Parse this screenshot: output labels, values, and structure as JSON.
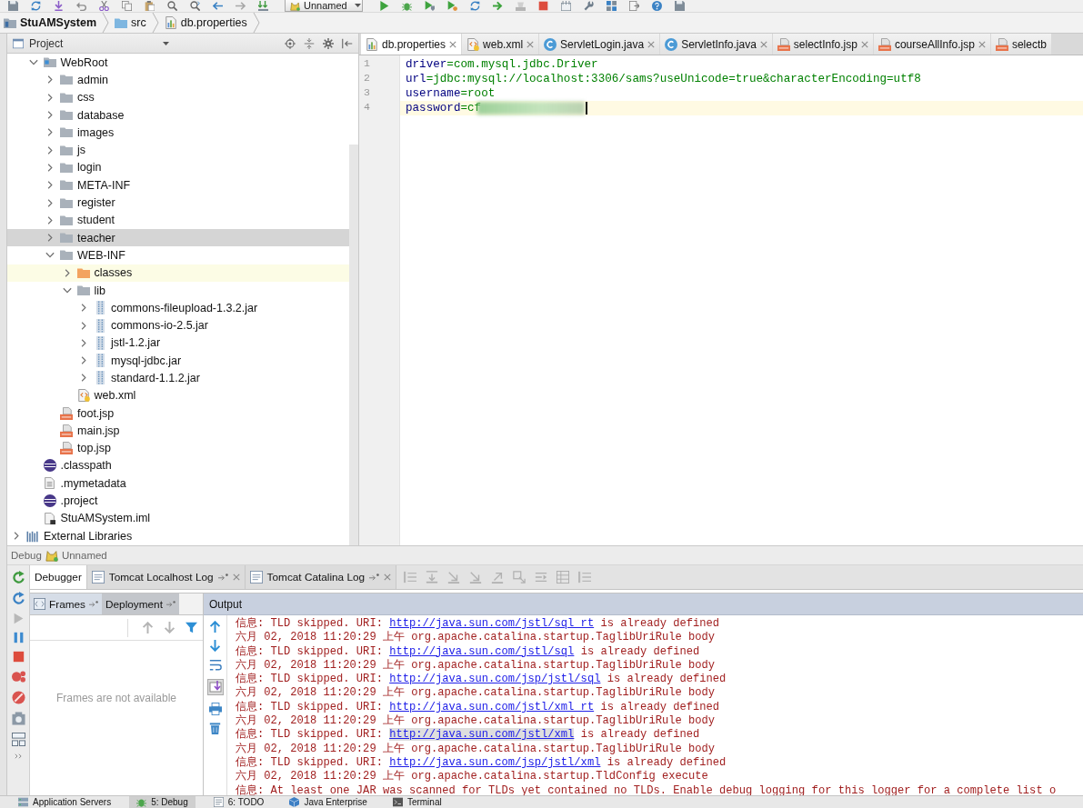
{
  "toolbar": {
    "run_configuration": "Unnamed"
  },
  "breadcrumbs": [
    {
      "label": "StuAMSystem",
      "kind": "module"
    },
    {
      "label": "src",
      "kind": "folder"
    },
    {
      "label": "db.properties",
      "kind": "properties"
    }
  ],
  "project_panel": {
    "title": "Project",
    "tree": {
      "scrolled_root_children": [
        {
          "label": "WebRoot",
          "kind": "web-folder",
          "expanded": true,
          "selected": false,
          "children": [
            {
              "label": "admin",
              "kind": "folder",
              "expanded": false,
              "selected": false
            },
            {
              "label": "css",
              "kind": "folder",
              "expanded": false,
              "selected": false
            },
            {
              "label": "database",
              "kind": "folder",
              "expanded": false,
              "selected": false
            },
            {
              "label": "images",
              "kind": "folder",
              "expanded": false,
              "selected": false
            },
            {
              "label": "js",
              "kind": "folder",
              "expanded": false,
              "selected": false
            },
            {
              "label": "login",
              "kind": "folder",
              "expanded": false,
              "selected": false
            },
            {
              "label": "META-INF",
              "kind": "folder",
              "expanded": false,
              "selected": false
            },
            {
              "label": "register",
              "kind": "folder",
              "expanded": false,
              "selected": false
            },
            {
              "label": "student",
              "kind": "folder",
              "expanded": false,
              "selected": false
            },
            {
              "label": "teacher",
              "kind": "folder",
              "expanded": false,
              "selected": true
            },
            {
              "label": "WEB-INF",
              "kind": "folder",
              "expanded": true,
              "selected": false,
              "children": [
                {
                  "label": "classes",
                  "kind": "excluded-folder",
                  "expanded": false,
                  "selected": false
                },
                {
                  "label": "lib",
                  "kind": "folder",
                  "expanded": true,
                  "selected": false,
                  "children": [
                    {
                      "label": "commons-fileupload-1.3.2.jar",
                      "kind": "jar",
                      "expanded": false,
                      "selected": false
                    },
                    {
                      "label": "commons-io-2.5.jar",
                      "kind": "jar",
                      "expanded": false,
                      "selected": false
                    },
                    {
                      "label": "jstl-1.2.jar",
                      "kind": "jar",
                      "expanded": false,
                      "selected": false
                    },
                    {
                      "label": "mysql-jdbc.jar",
                      "kind": "jar",
                      "expanded": false,
                      "selected": false
                    },
                    {
                      "label": "standard-1.1.2.jar",
                      "kind": "jar",
                      "expanded": false,
                      "selected": false
                    }
                  ]
                },
                {
                  "label": "web.xml",
                  "kind": "xml",
                  "selected": false
                }
              ]
            },
            {
              "label": "foot.jsp",
              "kind": "jsp",
              "selected": false
            },
            {
              "label": "main.jsp",
              "kind": "jsp",
              "selected": false
            },
            {
              "label": "top.jsp",
              "kind": "jsp",
              "selected": false
            }
          ]
        },
        {
          "label": ".classpath",
          "kind": "eclipse",
          "selected": false
        },
        {
          "label": ".mymetadata",
          "kind": "text",
          "selected": false
        },
        {
          "label": ".project",
          "kind": "eclipse",
          "selected": false
        },
        {
          "label": "StuAMSystem.iml",
          "kind": "iml",
          "selected": false
        }
      ],
      "items": [
        {
          "label": "External Libraries",
          "kind": "libraries",
          "expanded": false,
          "selected": false
        }
      ]
    }
  },
  "editor": {
    "tabs": [
      {
        "label": "db.properties",
        "kind": "properties",
        "selected": true
      },
      {
        "label": "web.xml",
        "kind": "xml",
        "selected": false
      },
      {
        "label": "ServletLogin.java",
        "kind": "class",
        "selected": false
      },
      {
        "label": "ServletInfo.java",
        "kind": "class",
        "selected": false
      },
      {
        "label": "selectInfo.jsp",
        "kind": "jsp",
        "selected": false
      },
      {
        "label": "courseAllInfo.jsp",
        "kind": "jsp",
        "selected": false
      },
      {
        "label": "selectb",
        "kind": "jsp",
        "selected": false
      }
    ],
    "lines": [
      {
        "number": "1",
        "key": "driver",
        "separator": "=",
        "value": "com.mysql.jdbc.Driver",
        "current": false
      },
      {
        "number": "2",
        "key": "url",
        "separator": "=",
        "value": "jdbc:mysql://localhost:3306/sams?useUnicode=true&characterEncoding=utf8",
        "current": false
      },
      {
        "number": "3",
        "key": "username",
        "separator": "=",
        "value": "root",
        "current": false
      },
      {
        "number": "4",
        "key": "password",
        "separator": "=",
        "value": "cf",
        "current": true,
        "blurred": true
      }
    ]
  },
  "debug": {
    "title": "Debug",
    "configuration": "Unnamed",
    "tabs": [
      {
        "label": "Debugger",
        "kind": "debugger",
        "selected": true
      },
      {
        "label": "Tomcat Localhost Log",
        "kind": "log",
        "selected": false
      },
      {
        "label": "Tomcat Catalina Log",
        "kind": "log",
        "selected": false
      }
    ],
    "frames_tabs": [
      {
        "label": "Frames",
        "kind": "frames",
        "selected": true
      },
      {
        "label": "Deployment",
        "kind": "deployment",
        "selected": false
      }
    ],
    "frames_empty_text": "Frames are not available",
    "output": {
      "title": "Output",
      "lines": [
        {
          "kind": "link",
          "before": "信息: TLD skipped. URI: ",
          "link": "http://java.sun.com/jstl/sql_rt",
          "after": " is already defined",
          "link_highlighted": false
        },
        {
          "kind": "plain",
          "text": "六月 02, 2018 11:20:29 上午 org.apache.catalina.startup.TaglibUriRule body"
        },
        {
          "kind": "link",
          "before": "信息: TLD skipped. URI: ",
          "link": "http://java.sun.com/jstl/sql",
          "after": " is already defined",
          "link_highlighted": false
        },
        {
          "kind": "plain",
          "text": "六月 02, 2018 11:20:29 上午 org.apache.catalina.startup.TaglibUriRule body"
        },
        {
          "kind": "link",
          "before": "信息: TLD skipped. URI: ",
          "link": "http://java.sun.com/jsp/jstl/sql",
          "after": " is already defined",
          "link_highlighted": false
        },
        {
          "kind": "plain",
          "text": "六月 02, 2018 11:20:29 上午 org.apache.catalina.startup.TaglibUriRule body"
        },
        {
          "kind": "link",
          "before": "信息: TLD skipped. URI: ",
          "link": "http://java.sun.com/jstl/xml_rt",
          "after": " is already defined",
          "link_highlighted": false
        },
        {
          "kind": "plain",
          "text": "六月 02, 2018 11:20:29 上午 org.apache.catalina.startup.TaglibUriRule body"
        },
        {
          "kind": "link",
          "before": "信息: TLD skipped. URI: ",
          "link": "http://java.sun.com/jstl/xml",
          "after": " is already defined",
          "link_highlighted": true
        },
        {
          "kind": "plain",
          "text": "六月 02, 2018 11:20:29 上午 org.apache.catalina.startup.TaglibUriRule body"
        },
        {
          "kind": "link",
          "before": "信息: TLD skipped. URI: ",
          "link": "http://java.sun.com/jsp/jstl/xml",
          "after": " is already defined",
          "link_highlighted": false
        },
        {
          "kind": "plain",
          "text": "六月 02, 2018 11:20:29 上午 org.apache.catalina.startup.TldConfig execute"
        },
        {
          "kind": "plain",
          "text": "信息: At least one JAR was scanned for TLDs yet contained no TLDs. Enable debug logging for this logger for a complete list o"
        }
      ]
    }
  },
  "bottom_bar": [
    {
      "label": "Application Servers",
      "kind": "servers",
      "selected": false
    },
    {
      "label": "5: Debug",
      "kind": "debug",
      "selected": true
    },
    {
      "label": "6: TODO",
      "kind": "todo",
      "selected": false
    },
    {
      "label": "Java Enterprise",
      "kind": "javaee",
      "selected": false
    },
    {
      "label": "Terminal",
      "kind": "terminal",
      "selected": false
    }
  ]
}
